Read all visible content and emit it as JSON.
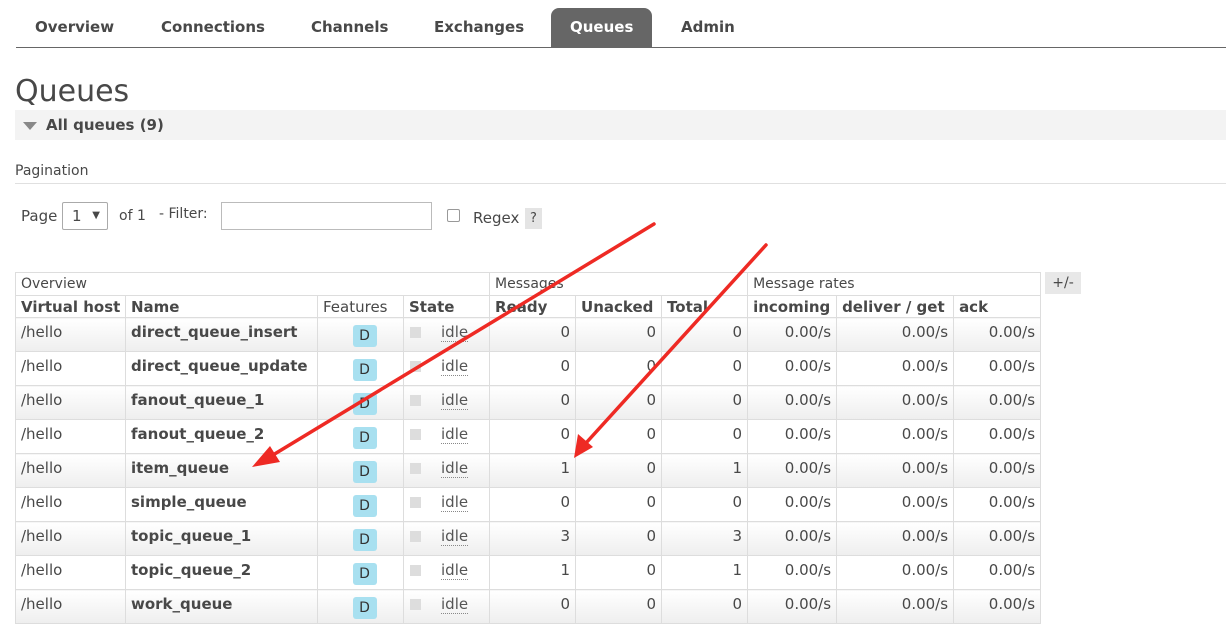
{
  "tabs": [
    {
      "label": "Overview",
      "active": false
    },
    {
      "label": "Connections",
      "active": false
    },
    {
      "label": "Channels",
      "active": false
    },
    {
      "label": "Exchanges",
      "active": false
    },
    {
      "label": "Queues",
      "active": true
    },
    {
      "label": "Admin",
      "active": false
    }
  ],
  "page_title": "Queues",
  "section": {
    "title": "All queues (9)",
    "icon": "triangle-down-icon"
  },
  "pagination": {
    "heading": "Pagination",
    "page_label": "Page",
    "page_value": "1",
    "of_label": "of 1",
    "filter_label": "- Filter:",
    "filter_value": "",
    "regex_label": "Regex",
    "regex_checked": false,
    "help_label": "?"
  },
  "table": {
    "groups": [
      "Overview",
      "Messages",
      "Message rates"
    ],
    "columns": [
      "Virtual host",
      "Name",
      "Features",
      "State",
      "Ready",
      "Unacked",
      "Total",
      "incoming",
      "deliver / get",
      "ack"
    ],
    "toggle_label": "+/-",
    "rows": [
      {
        "vhost": "/hello",
        "name": "direct_queue_insert",
        "feature": "D",
        "state": "idle",
        "ready": "0",
        "unacked": "0",
        "total": "0",
        "incoming": "0.00/s",
        "deliver": "0.00/s",
        "ack": "0.00/s"
      },
      {
        "vhost": "/hello",
        "name": "direct_queue_update",
        "feature": "D",
        "state": "idle",
        "ready": "0",
        "unacked": "0",
        "total": "0",
        "incoming": "0.00/s",
        "deliver": "0.00/s",
        "ack": "0.00/s"
      },
      {
        "vhost": "/hello",
        "name": "fanout_queue_1",
        "feature": "D",
        "state": "idle",
        "ready": "0",
        "unacked": "0",
        "total": "0",
        "incoming": "0.00/s",
        "deliver": "0.00/s",
        "ack": "0.00/s"
      },
      {
        "vhost": "/hello",
        "name": "fanout_queue_2",
        "feature": "D",
        "state": "idle",
        "ready": "0",
        "unacked": "0",
        "total": "0",
        "incoming": "0.00/s",
        "deliver": "0.00/s",
        "ack": "0.00/s"
      },
      {
        "vhost": "/hello",
        "name": "item_queue",
        "feature": "D",
        "state": "idle",
        "ready": "1",
        "unacked": "0",
        "total": "1",
        "incoming": "0.00/s",
        "deliver": "0.00/s",
        "ack": "0.00/s"
      },
      {
        "vhost": "/hello",
        "name": "simple_queue",
        "feature": "D",
        "state": "idle",
        "ready": "0",
        "unacked": "0",
        "total": "0",
        "incoming": "0.00/s",
        "deliver": "0.00/s",
        "ack": "0.00/s"
      },
      {
        "vhost": "/hello",
        "name": "topic_queue_1",
        "feature": "D",
        "state": "idle",
        "ready": "3",
        "unacked": "0",
        "total": "3",
        "incoming": "0.00/s",
        "deliver": "0.00/s",
        "ack": "0.00/s"
      },
      {
        "vhost": "/hello",
        "name": "topic_queue_2",
        "feature": "D",
        "state": "idle",
        "ready": "1",
        "unacked": "0",
        "total": "1",
        "incoming": "0.00/s",
        "deliver": "0.00/s",
        "ack": "0.00/s"
      },
      {
        "vhost": "/hello",
        "name": "work_queue",
        "feature": "D",
        "state": "idle",
        "ready": "0",
        "unacked": "0",
        "total": "0",
        "incoming": "0.00/s",
        "deliver": "0.00/s",
        "ack": "0.00/s"
      }
    ]
  },
  "colors": {
    "active_tab": "#666666",
    "feature_badge": "#a8e0f0",
    "annotation_arrow": "#ee2a24"
  }
}
